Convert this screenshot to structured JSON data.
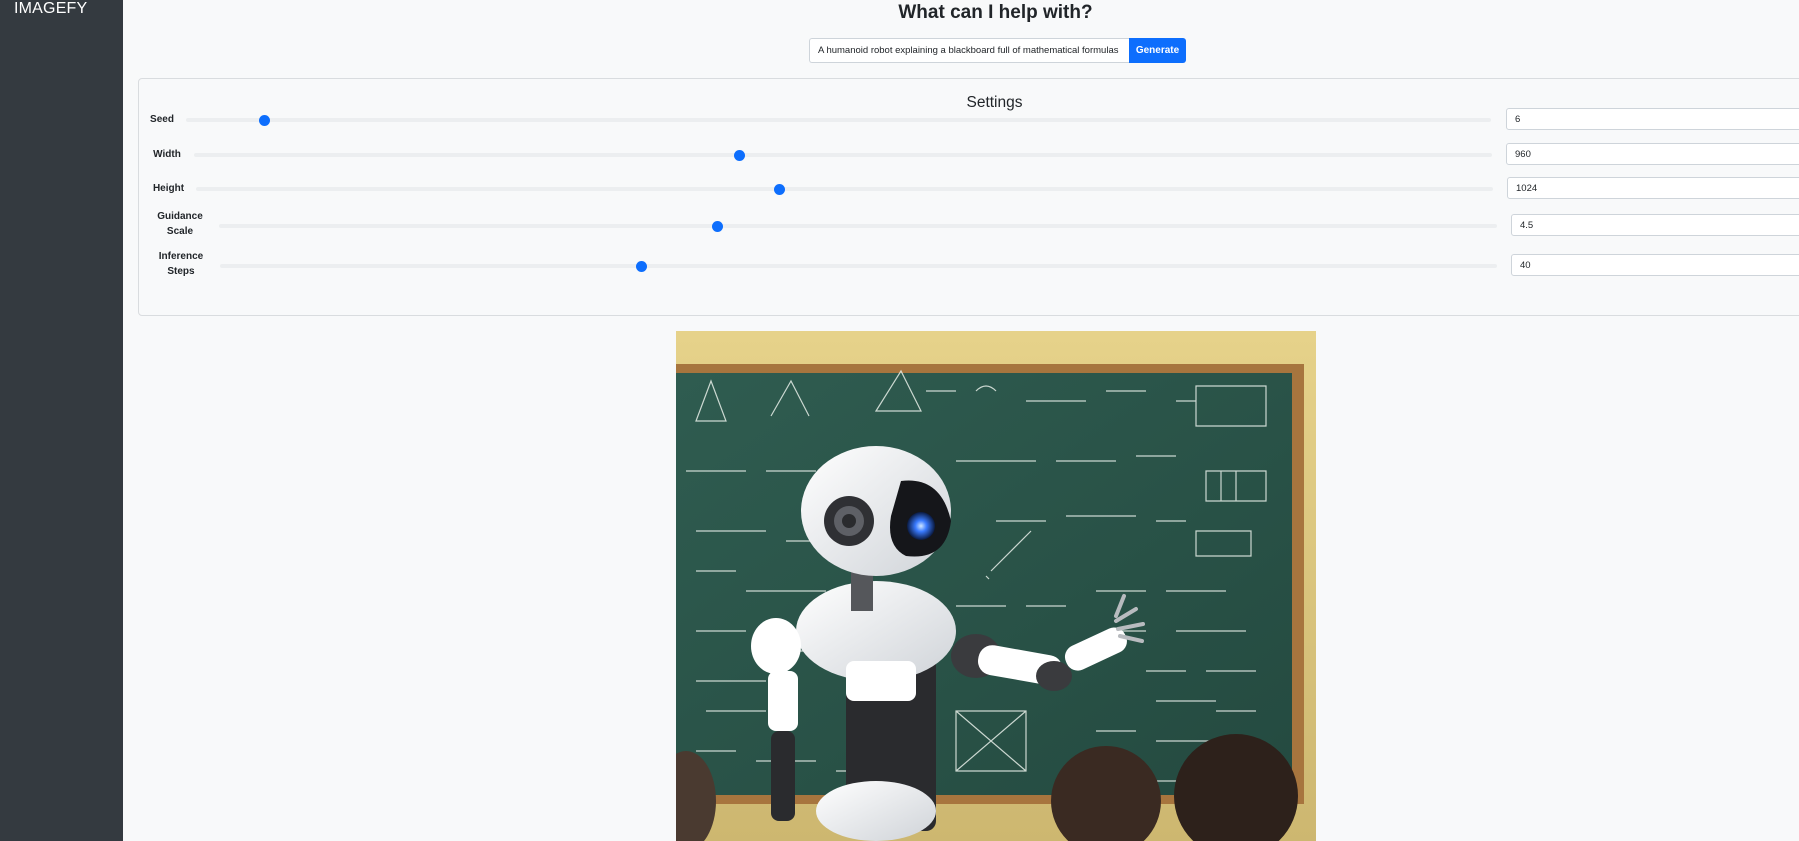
{
  "app": {
    "brand": "IMAGEFY"
  },
  "header": {
    "title": "What can I help with?"
  },
  "prompt": {
    "value": "A humanoid robot explaining a blackboard full of mathematical formulas",
    "button_label": "Generate"
  },
  "settings": {
    "title": "Settings",
    "items": [
      {
        "label": "Seed",
        "value": "6",
        "level": 0.06
      },
      {
        "label": "Width",
        "value": "960",
        "level": 0.42
      },
      {
        "label": "Height",
        "value": "1024",
        "level": 0.45
      },
      {
        "label": "Guidance\nScale",
        "value": "4.5",
        "level": 0.39
      },
      {
        "label": "Inference\nSteps",
        "value": "40",
        "level": 0.33
      }
    ]
  },
  "colors": {
    "accent": "#0d6efd",
    "sidebar": "#343a40",
    "background": "#f8f9fa"
  },
  "output": {
    "image_subject": "humanoid robot at chalkboard"
  }
}
